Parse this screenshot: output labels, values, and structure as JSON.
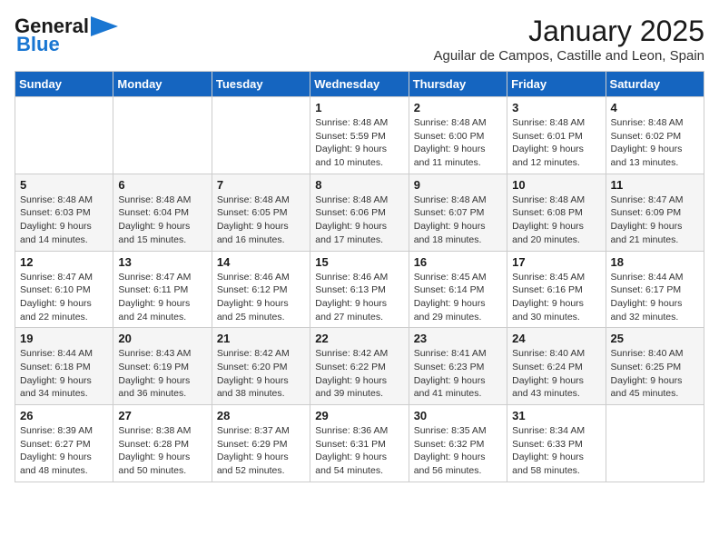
{
  "header": {
    "logo_general": "General",
    "logo_blue": "Blue",
    "month_title": "January 2025",
    "subtitle": "Aguilar de Campos, Castille and Leon, Spain"
  },
  "weekdays": [
    "Sunday",
    "Monday",
    "Tuesday",
    "Wednesday",
    "Thursday",
    "Friday",
    "Saturday"
  ],
  "weeks": [
    [
      {
        "day": "",
        "info": ""
      },
      {
        "day": "",
        "info": ""
      },
      {
        "day": "",
        "info": ""
      },
      {
        "day": "1",
        "info": "Sunrise: 8:48 AM\nSunset: 5:59 PM\nDaylight: 9 hours\nand 10 minutes."
      },
      {
        "day": "2",
        "info": "Sunrise: 8:48 AM\nSunset: 6:00 PM\nDaylight: 9 hours\nand 11 minutes."
      },
      {
        "day": "3",
        "info": "Sunrise: 8:48 AM\nSunset: 6:01 PM\nDaylight: 9 hours\nand 12 minutes."
      },
      {
        "day": "4",
        "info": "Sunrise: 8:48 AM\nSunset: 6:02 PM\nDaylight: 9 hours\nand 13 minutes."
      }
    ],
    [
      {
        "day": "5",
        "info": "Sunrise: 8:48 AM\nSunset: 6:03 PM\nDaylight: 9 hours\nand 14 minutes."
      },
      {
        "day": "6",
        "info": "Sunrise: 8:48 AM\nSunset: 6:04 PM\nDaylight: 9 hours\nand 15 minutes."
      },
      {
        "day": "7",
        "info": "Sunrise: 8:48 AM\nSunset: 6:05 PM\nDaylight: 9 hours\nand 16 minutes."
      },
      {
        "day": "8",
        "info": "Sunrise: 8:48 AM\nSunset: 6:06 PM\nDaylight: 9 hours\nand 17 minutes."
      },
      {
        "day": "9",
        "info": "Sunrise: 8:48 AM\nSunset: 6:07 PM\nDaylight: 9 hours\nand 18 minutes."
      },
      {
        "day": "10",
        "info": "Sunrise: 8:48 AM\nSunset: 6:08 PM\nDaylight: 9 hours\nand 20 minutes."
      },
      {
        "day": "11",
        "info": "Sunrise: 8:47 AM\nSunset: 6:09 PM\nDaylight: 9 hours\nand 21 minutes."
      }
    ],
    [
      {
        "day": "12",
        "info": "Sunrise: 8:47 AM\nSunset: 6:10 PM\nDaylight: 9 hours\nand 22 minutes."
      },
      {
        "day": "13",
        "info": "Sunrise: 8:47 AM\nSunset: 6:11 PM\nDaylight: 9 hours\nand 24 minutes."
      },
      {
        "day": "14",
        "info": "Sunrise: 8:46 AM\nSunset: 6:12 PM\nDaylight: 9 hours\nand 25 minutes."
      },
      {
        "day": "15",
        "info": "Sunrise: 8:46 AM\nSunset: 6:13 PM\nDaylight: 9 hours\nand 27 minutes."
      },
      {
        "day": "16",
        "info": "Sunrise: 8:45 AM\nSunset: 6:14 PM\nDaylight: 9 hours\nand 29 minutes."
      },
      {
        "day": "17",
        "info": "Sunrise: 8:45 AM\nSunset: 6:16 PM\nDaylight: 9 hours\nand 30 minutes."
      },
      {
        "day": "18",
        "info": "Sunrise: 8:44 AM\nSunset: 6:17 PM\nDaylight: 9 hours\nand 32 minutes."
      }
    ],
    [
      {
        "day": "19",
        "info": "Sunrise: 8:44 AM\nSunset: 6:18 PM\nDaylight: 9 hours\nand 34 minutes."
      },
      {
        "day": "20",
        "info": "Sunrise: 8:43 AM\nSunset: 6:19 PM\nDaylight: 9 hours\nand 36 minutes."
      },
      {
        "day": "21",
        "info": "Sunrise: 8:42 AM\nSunset: 6:20 PM\nDaylight: 9 hours\nand 38 minutes."
      },
      {
        "day": "22",
        "info": "Sunrise: 8:42 AM\nSunset: 6:22 PM\nDaylight: 9 hours\nand 39 minutes."
      },
      {
        "day": "23",
        "info": "Sunrise: 8:41 AM\nSunset: 6:23 PM\nDaylight: 9 hours\nand 41 minutes."
      },
      {
        "day": "24",
        "info": "Sunrise: 8:40 AM\nSunset: 6:24 PM\nDaylight: 9 hours\nand 43 minutes."
      },
      {
        "day": "25",
        "info": "Sunrise: 8:40 AM\nSunset: 6:25 PM\nDaylight: 9 hours\nand 45 minutes."
      }
    ],
    [
      {
        "day": "26",
        "info": "Sunrise: 8:39 AM\nSunset: 6:27 PM\nDaylight: 9 hours\nand 48 minutes."
      },
      {
        "day": "27",
        "info": "Sunrise: 8:38 AM\nSunset: 6:28 PM\nDaylight: 9 hours\nand 50 minutes."
      },
      {
        "day": "28",
        "info": "Sunrise: 8:37 AM\nSunset: 6:29 PM\nDaylight: 9 hours\nand 52 minutes."
      },
      {
        "day": "29",
        "info": "Sunrise: 8:36 AM\nSunset: 6:31 PM\nDaylight: 9 hours\nand 54 minutes."
      },
      {
        "day": "30",
        "info": "Sunrise: 8:35 AM\nSunset: 6:32 PM\nDaylight: 9 hours\nand 56 minutes."
      },
      {
        "day": "31",
        "info": "Sunrise: 8:34 AM\nSunset: 6:33 PM\nDaylight: 9 hours\nand 58 minutes."
      },
      {
        "day": "",
        "info": ""
      }
    ]
  ]
}
